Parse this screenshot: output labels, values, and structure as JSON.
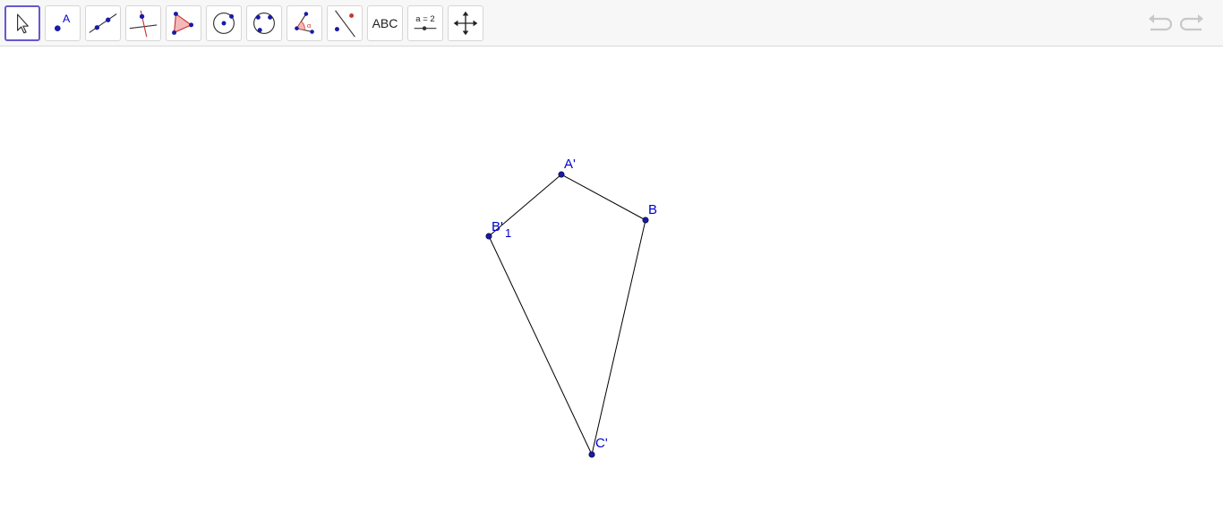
{
  "toolbar": {
    "tools": [
      {
        "name": "move-tool",
        "icon": "arrow-cursor-icon",
        "selected": true
      },
      {
        "name": "point-tool",
        "icon": "point-icon",
        "label": "A"
      },
      {
        "name": "line-tool",
        "icon": "line-through-two-points-icon"
      },
      {
        "name": "perpendicular-line-tool",
        "icon": "perpendicular-line-icon"
      },
      {
        "name": "polygon-tool",
        "icon": "polygon-icon"
      },
      {
        "name": "circle-tool",
        "icon": "circle-center-point-icon"
      },
      {
        "name": "circle-three-points-tool",
        "icon": "circle-three-points-icon"
      },
      {
        "name": "angle-tool",
        "icon": "angle-icon",
        "label": "α"
      },
      {
        "name": "reflect-tool",
        "icon": "reflect-about-line-icon"
      },
      {
        "name": "text-tool",
        "icon": "text-icon",
        "label": "ABC"
      },
      {
        "name": "slider-tool",
        "icon": "slider-icon",
        "label": "a = 2"
      },
      {
        "name": "move-graphics-view-tool",
        "icon": "move-graphics-view-icon"
      }
    ],
    "undo_icon": "undo-icon",
    "redo_icon": "redo-icon"
  },
  "colors": {
    "accent": "#6557d2",
    "point": "#0000cc",
    "segment": "#000000",
    "polygon_fill": "#f4b8b8",
    "polygon_stroke": "#cc3333"
  },
  "construction": {
    "points": [
      {
        "id": "A1",
        "label": "A'",
        "sub": ""
      },
      {
        "id": "B",
        "label": "B",
        "sub": ""
      },
      {
        "id": "C1",
        "label": "C'",
        "sub": ""
      },
      {
        "id": "B1",
        "label": "B'",
        "sub": "1"
      }
    ],
    "segments": [
      [
        "B1",
        "A1"
      ],
      [
        "A1",
        "B"
      ],
      [
        "B",
        "C1"
      ],
      [
        "C1",
        "B1"
      ]
    ]
  }
}
